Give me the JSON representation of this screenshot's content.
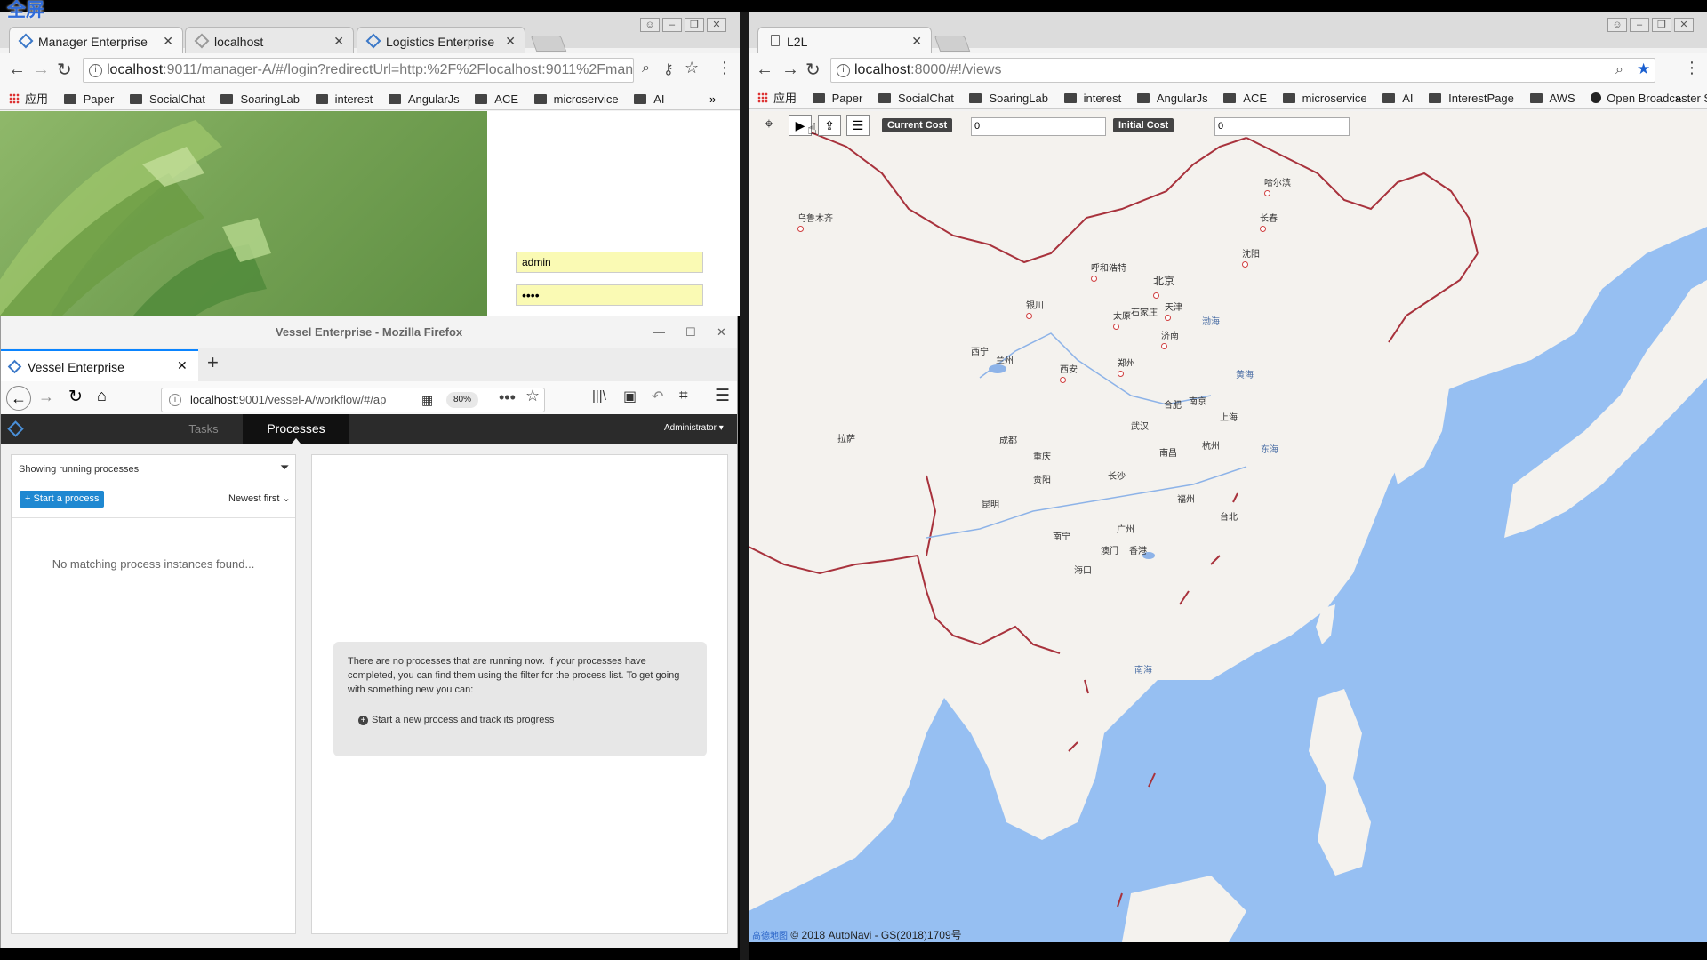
{
  "screen_label": "全屏",
  "left_chrome": {
    "tabs": [
      {
        "label": "Manager Enterprise",
        "icon": "diamond-icon"
      },
      {
        "label": "localhost",
        "icon": "diamond-icon"
      },
      {
        "label": "Logistics Enterprise",
        "icon": "diamond-icon"
      }
    ],
    "url_host": "localhost",
    "url_rest": ":9011/manager-A/#/login?redirectUrl=http:%2F%2Flocalhost:9011%2Fmanager-...",
    "bookmarks": [
      "应用",
      "Paper",
      "SocialChat",
      "SoaringLab",
      "interest",
      "AngularJs",
      "ACE",
      "microservice",
      "AI"
    ],
    "overflow": "»",
    "login": {
      "username": "admin",
      "password": "••••"
    }
  },
  "firefox": {
    "title": "Vessel Enterprise - Mozilla Firefox",
    "tab_label": "Vessel Enterprise",
    "url_host": "localhost",
    "url_rest": ":9001/vessel-A/workflow/#/ap",
    "zoom": "80%",
    "nav": {
      "tasks": "Tasks",
      "processes": "Processes",
      "user": "Administrator"
    },
    "list": {
      "filter_label": "Showing running processes",
      "start_button": "+ Start a process",
      "sort_label": "Newest first",
      "empty_text": "No matching process instances found..."
    },
    "info": {
      "message": "There are no processes that are running now. If your processes have completed, you can find them using the filter for the process list. To get going with something new you can:",
      "action": "Start a new process and track its progress"
    }
  },
  "right_chrome": {
    "tab_label": "L2L",
    "url_host": "localhost",
    "url_rest": ":8000/#!/views",
    "bookmarks": [
      "应用",
      "Paper",
      "SocialChat",
      "SoaringLab",
      "interest",
      "AngularJs",
      "ACE",
      "microservice",
      "AI",
      "InterestPage",
      "AWS",
      "Open Broadcaster S"
    ],
    "overflow": "»",
    "map_toolbar": {
      "current_cost_label": "Current Cost",
      "current_cost_value": "0",
      "initial_cost_label": "Initial Cost",
      "initial_cost_value": "0"
    },
    "attribution": "© 2018 AutoNavi - GS(2018)1709号",
    "attribution_logo": "高德地图",
    "cities": [
      "乌鲁木齐",
      "哈尔滨",
      "长春",
      "沈阳",
      "呼和浩特",
      "北京",
      "天津",
      "银川",
      "太原",
      "石家庄",
      "济南",
      "西宁",
      "兰州",
      "西安",
      "郑州",
      "拉萨",
      "成都",
      "重庆",
      "武汉",
      "合肥",
      "南京",
      "上海",
      "杭州",
      "长沙",
      "南昌",
      "贵阳",
      "福州",
      "台北",
      "昆明",
      "南宁",
      "广州",
      "澳门",
      "香港",
      "海口"
    ],
    "seas": [
      "渤海",
      "黄海",
      "东海",
      "南海"
    ]
  }
}
